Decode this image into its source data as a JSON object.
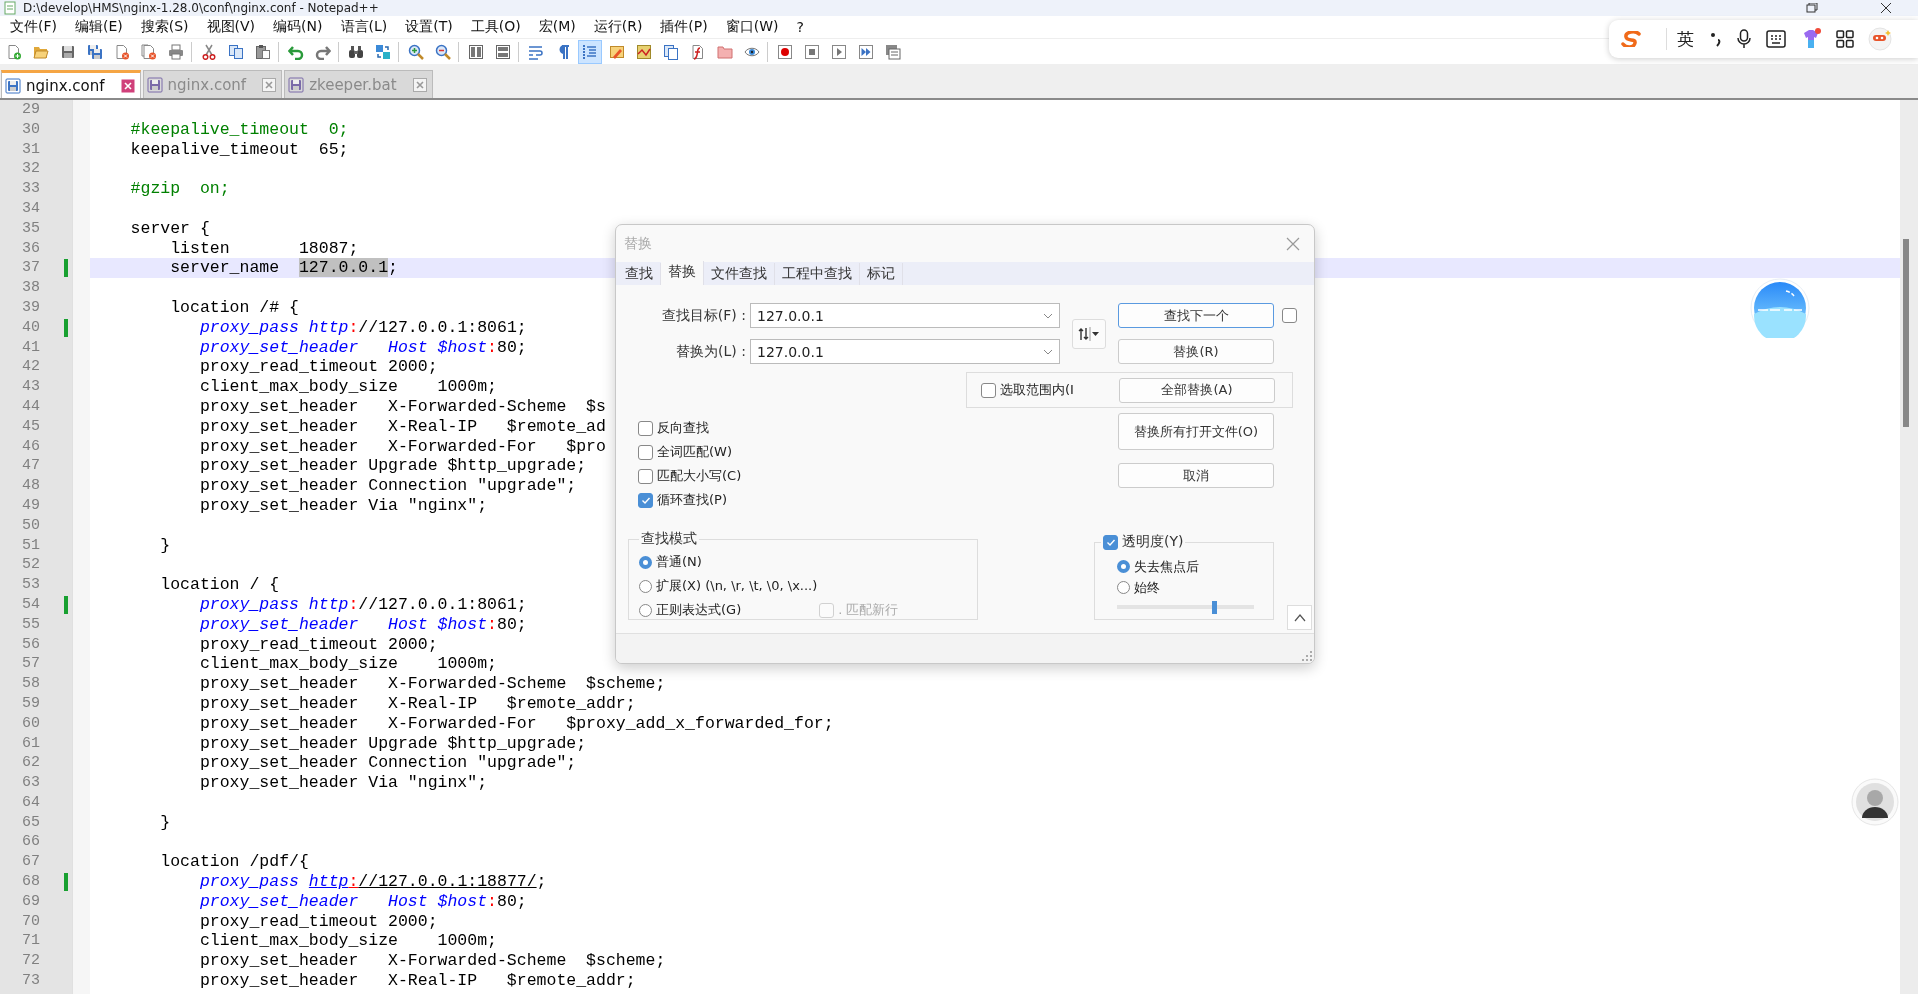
{
  "window": {
    "title": "D:\\develop\\HMS\\nginx-1.28.0\\conf\\nginx.conf - Notepad++"
  },
  "menu": [
    "文件(F)",
    "编辑(E)",
    "搜索(S)",
    "视图(V)",
    "编码(N)",
    "语言(L)",
    "设置(T)",
    "工具(O)",
    "宏(M)",
    "运行(R)",
    "插件(P)",
    "窗口(W)",
    "?"
  ],
  "toolbar": [
    {
      "pressed": false
    },
    {
      "pressed": false
    },
    {
      "pressed": false
    },
    {
      "pressed": false
    },
    {
      "pressed": false
    },
    {
      "pressed": false
    },
    {
      "pressed": false
    },
    {
      "pressed": false
    },
    {
      "pressed": false
    },
    {
      "pressed": false
    },
    {
      "pressed": false
    },
    {
      "pressed": false
    },
    {
      "pressed": false
    },
    {
      "pressed": false
    },
    {
      "pressed": false
    },
    {
      "pressed": false
    },
    {
      "pressed": false
    },
    {
      "pressed": false
    },
    {
      "pressed": false
    },
    {
      "pressed": false
    },
    {
      "pressed": true
    },
    {
      "pressed": false
    },
    {
      "pressed": false
    },
    {
      "pressed": false
    },
    {
      "pressed": false
    },
    {
      "pressed": false
    },
    {
      "pressed": false
    },
    {
      "pressed": false
    },
    {
      "pressed": false
    },
    {
      "pressed": false
    },
    {
      "pressed": false
    },
    {
      "pressed": false
    }
  ],
  "tabs": [
    {
      "label": "nginx.conf",
      "selected": true
    },
    {
      "label": "nginx.conf",
      "selected": false
    },
    {
      "label": "zkeeper.bat",
      "selected": false
    }
  ],
  "editor": {
    "lines": [
      {
        "number": "29",
        "changed": false,
        "current": false
      },
      {
        "number": "30",
        "changed": false,
        "current": false,
        "segments": [
          {
            "kind": "comment",
            "text": "    #keepalive_timeout  0;"
          }
        ]
      },
      {
        "number": "31",
        "changed": false,
        "current": false,
        "segments": [
          {
            "kind": "plain",
            "text": "    keepalive_timeout  65;"
          }
        ]
      },
      {
        "number": "32",
        "changed": false,
        "current": false
      },
      {
        "number": "33",
        "changed": false,
        "current": false,
        "segments": [
          {
            "kind": "comment",
            "text": "    #gzip  on;"
          }
        ]
      },
      {
        "number": "34",
        "changed": false,
        "current": false
      },
      {
        "number": "35",
        "changed": false,
        "current": false,
        "segments": [
          {
            "kind": "plain",
            "text": "    server {"
          }
        ]
      },
      {
        "number": "36",
        "changed": false,
        "current": false,
        "segments": [
          {
            "kind": "plain",
            "text": "        listen       18087;"
          }
        ]
      },
      {
        "number": "37",
        "changed": true,
        "current": true,
        "segments": [
          {
            "kind": "plain",
            "text": "        server_name  "
          },
          {
            "kind": "selection",
            "text": "127.0.0.1"
          },
          {
            "kind": "plain",
            "text": ";"
          }
        ]
      },
      {
        "number": "38",
        "changed": false,
        "current": false
      },
      {
        "number": "39",
        "changed": false,
        "current": false,
        "segments": [
          {
            "kind": "plain",
            "text": "        location /# {"
          }
        ]
      },
      {
        "number": "40",
        "changed": true,
        "current": false,
        "segments": [
          {
            "kind": "keyword",
            "text": "           proxy_pass "
          },
          {
            "kind": "keyword",
            "text": "http"
          },
          {
            "kind": "punct",
            "text": ":"
          },
          {
            "kind": "plain",
            "text": "//127.0.0.1:8061;"
          }
        ]
      },
      {
        "number": "41",
        "changed": false,
        "current": false,
        "segments": [
          {
            "kind": "keyword",
            "text": "           proxy_set_header   Host $host"
          },
          {
            "kind": "punct",
            "text": ":"
          },
          {
            "kind": "plain",
            "text": "80;"
          }
        ]
      },
      {
        "number": "42",
        "changed": false,
        "current": false,
        "segments": [
          {
            "kind": "plain",
            "text": "           proxy_read_timeout 2000;"
          }
        ]
      },
      {
        "number": "43",
        "changed": false,
        "current": false,
        "segments": [
          {
            "kind": "plain",
            "text": "           client_max_body_size    1000m;"
          }
        ]
      },
      {
        "number": "44",
        "changed": false,
        "current": false,
        "segments": [
          {
            "kind": "plain",
            "text": "           proxy_set_header   X-Forwarded-Scheme  $s"
          }
        ]
      },
      {
        "number": "45",
        "changed": false,
        "current": false,
        "segments": [
          {
            "kind": "plain",
            "text": "           proxy_set_header   X-Real-IP   $remote_ad"
          }
        ]
      },
      {
        "number": "46",
        "changed": false,
        "current": false,
        "segments": [
          {
            "kind": "plain",
            "text": "           proxy_set_header   X-Forwarded-For   $pro"
          }
        ]
      },
      {
        "number": "47",
        "changed": false,
        "current": false,
        "segments": [
          {
            "kind": "plain",
            "text": "           proxy_set_header Upgrade $http_upgrade;"
          }
        ]
      },
      {
        "number": "48",
        "changed": false,
        "current": false,
        "segments": [
          {
            "kind": "plain",
            "text": "           proxy_set_header Connection \"upgrade\";"
          }
        ]
      },
      {
        "number": "49",
        "changed": false,
        "current": false,
        "segments": [
          {
            "kind": "plain",
            "text": "           proxy_set_header Via \"nginx\";"
          }
        ]
      },
      {
        "number": "50",
        "changed": false,
        "current": false
      },
      {
        "number": "51",
        "changed": false,
        "current": false,
        "segments": [
          {
            "kind": "plain",
            "text": "       }"
          }
        ]
      },
      {
        "number": "52",
        "changed": false,
        "current": false
      },
      {
        "number": "53",
        "changed": false,
        "current": false,
        "segments": [
          {
            "kind": "plain",
            "text": "       location / {"
          }
        ]
      },
      {
        "number": "54",
        "changed": true,
        "current": false,
        "segments": [
          {
            "kind": "keyword",
            "text": "           proxy_pass "
          },
          {
            "kind": "keyword",
            "text": "http"
          },
          {
            "kind": "punct",
            "text": ":"
          },
          {
            "kind": "plain",
            "text": "//127.0.0.1:8061;"
          }
        ]
      },
      {
        "number": "55",
        "changed": false,
        "current": false,
        "segments": [
          {
            "kind": "keyword",
            "text": "           proxy_set_header   Host $host"
          },
          {
            "kind": "punct",
            "text": ":"
          },
          {
            "kind": "plain",
            "text": "80;"
          }
        ]
      },
      {
        "number": "56",
        "changed": false,
        "current": false,
        "segments": [
          {
            "kind": "plain",
            "text": "           proxy_read_timeout 2000;"
          }
        ]
      },
      {
        "number": "57",
        "changed": false,
        "current": false,
        "segments": [
          {
            "kind": "plain",
            "text": "           client_max_body_size    1000m;"
          }
        ]
      },
      {
        "number": "58",
        "changed": false,
        "current": false,
        "segments": [
          {
            "kind": "plain",
            "text": "           proxy_set_header   X-Forwarded-Scheme  $scheme;"
          }
        ]
      },
      {
        "number": "59",
        "changed": false,
        "current": false,
        "segments": [
          {
            "kind": "plain",
            "text": "           proxy_set_header   X-Real-IP   $remote_addr;"
          }
        ]
      },
      {
        "number": "60",
        "changed": false,
        "current": false,
        "segments": [
          {
            "kind": "plain",
            "text": "           proxy_set_header   X-Forwarded-For   $proxy_add_x_forwarded_for;"
          }
        ]
      },
      {
        "number": "61",
        "changed": false,
        "current": false,
        "segments": [
          {
            "kind": "plain",
            "text": "           proxy_set_header Upgrade $http_upgrade;"
          }
        ]
      },
      {
        "number": "62",
        "changed": false,
        "current": false,
        "segments": [
          {
            "kind": "plain",
            "text": "           proxy_set_header Connection \"upgrade\";"
          }
        ]
      },
      {
        "number": "63",
        "changed": false,
        "current": false,
        "segments": [
          {
            "kind": "plain",
            "text": "           proxy_set_header Via \"nginx\";"
          }
        ]
      },
      {
        "number": "64",
        "changed": false,
        "current": false
      },
      {
        "number": "65",
        "changed": false,
        "current": false,
        "segments": [
          {
            "kind": "plain",
            "text": "       }"
          }
        ]
      },
      {
        "number": "66",
        "changed": false,
        "current": false
      },
      {
        "number": "67",
        "changed": false,
        "current": false,
        "segments": [
          {
            "kind": "plain",
            "text": "       location /pdf/{"
          }
        ]
      },
      {
        "number": "68",
        "changed": true,
        "current": false,
        "segments": [
          {
            "kind": "keyword",
            "text": "           proxy_pass "
          },
          {
            "kind": "link_keyword",
            "text": "http"
          },
          {
            "kind": "link_punct",
            "text": ":"
          },
          {
            "kind": "link",
            "text": "//127.0.0.1:18877/"
          },
          {
            "kind": "plain",
            "text": ";"
          }
        ]
      },
      {
        "number": "69",
        "changed": false,
        "current": false,
        "segments": [
          {
            "kind": "keyword",
            "text": "           proxy_set_header   Host $host"
          },
          {
            "kind": "punct",
            "text": ":"
          },
          {
            "kind": "plain",
            "text": "80;"
          }
        ]
      },
      {
        "number": "70",
        "changed": false,
        "current": false,
        "segments": [
          {
            "kind": "plain",
            "text": "           proxy_read_timeout 2000;"
          }
        ]
      },
      {
        "number": "71",
        "changed": false,
        "current": false,
        "segments": [
          {
            "kind": "plain",
            "text": "           client_max_body_size    1000m;"
          }
        ]
      },
      {
        "number": "72",
        "changed": false,
        "current": false,
        "segments": [
          {
            "kind": "plain",
            "text": "           proxy_set_header   X-Forwarded-Scheme  $scheme;"
          }
        ]
      },
      {
        "number": "73",
        "changed": false,
        "current": false,
        "segments": [
          {
            "kind": "plain",
            "text": "           proxy_set_header   X-Real-IP   $remote_addr;"
          }
        ]
      }
    ]
  },
  "find_dialog": {
    "title": "替换",
    "tabs": [
      {
        "label": "查找",
        "selected": false
      },
      {
        "label": "替换",
        "selected": true
      },
      {
        "label": "文件查找",
        "selected": false
      },
      {
        "label": "工程中查找",
        "selected": false
      },
      {
        "label": "标记",
        "selected": false
      }
    ],
    "fields": [
      {
        "label": "查找目标(F) :",
        "value": "127.0.0.1"
      },
      {
        "label": "替换为(L) :",
        "value": "127.0.0.1"
      }
    ],
    "buttons": [
      {
        "label": "查找下一个",
        "focused": true
      },
      {
        "label": "替换(R)",
        "focused": false
      },
      {
        "label": "全部替换(A)",
        "focused": false
      },
      {
        "label": "替换所有打开文件(O)",
        "focused": false
      },
      {
        "label": "取消",
        "focused": false
      }
    ],
    "side_checkbox": {
      "checked": false
    },
    "in_selection": {
      "label": "选取范围内(I",
      "checked": false
    },
    "options": [
      {
        "label": "反向查找",
        "checked": false
      },
      {
        "label": "全词匹配(W)",
        "checked": false
      },
      {
        "label": "匹配大小写(C)",
        "checked": false
      },
      {
        "label": "循环查找(P)",
        "checked": true
      }
    ],
    "search_mode": {
      "title": "查找模式",
      "options": [
        {
          "label": "普通(N)",
          "selected": true
        },
        {
          "label": "扩展(X) (\\n, \\r, \\t, \\0, \\x...)",
          "selected": false
        },
        {
          "label": "正则表达式(G)",
          "selected": false
        }
      ],
      "newline_option": {
        "label": ". 匹配新行",
        "checked": false,
        "disabled": true
      }
    },
    "transparency": {
      "label": "透明度(Y)",
      "checked": true,
      "options": [
        {
          "label": "失去焦点后",
          "selected": true
        },
        {
          "label": "始终",
          "selected": false
        }
      ],
      "level": 0.71
    }
  },
  "ime_bar": {
    "language": "英"
  }
}
